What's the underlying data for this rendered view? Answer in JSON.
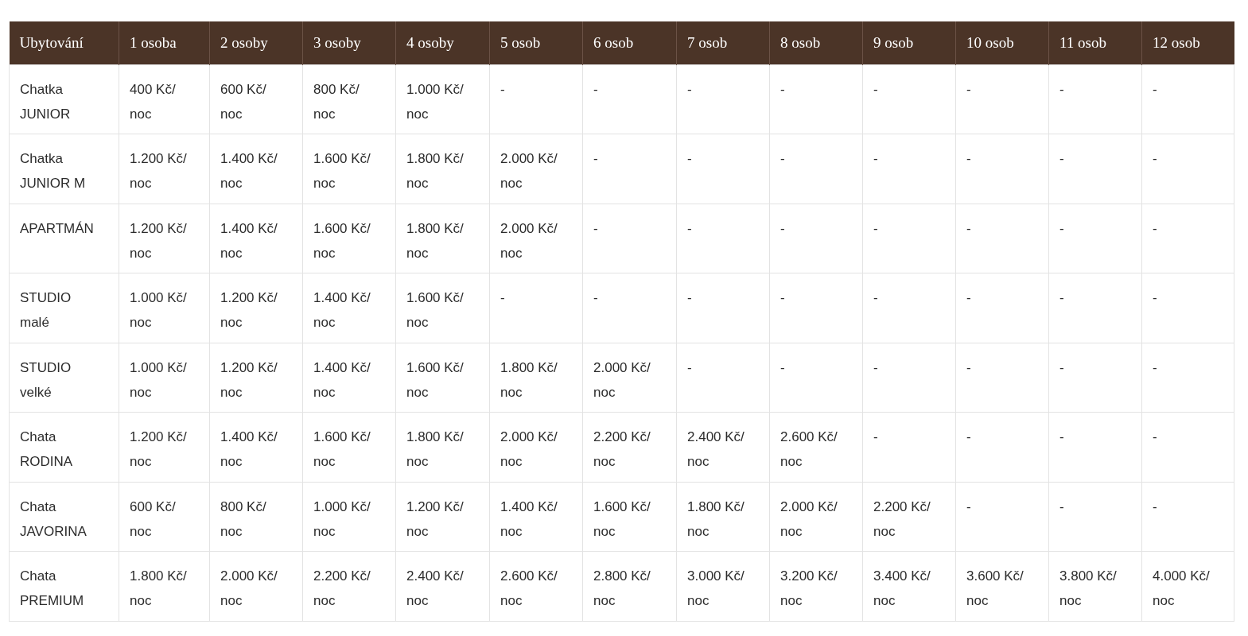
{
  "table": {
    "columns": [
      "Ubytování",
      "1 osoba",
      "2 osoby",
      "3 osoby",
      "4 osoby",
      "5 osob",
      "6 osob",
      "7 osob",
      "8 osob",
      "9 osob",
      "10 osob",
      "11 osob",
      "12 osob"
    ],
    "rows": [
      [
        "Chatka JUNIOR",
        "400 Kč/ noc",
        "600 Kč/ noc",
        "800 Kč/ noc",
        "1.000 Kč/ noc",
        "-",
        "-",
        "-",
        "-",
        "-",
        "-",
        "-",
        "-"
      ],
      [
        "Chatka JUNIOR M",
        "1.200 Kč/ noc",
        "1.400 Kč/ noc",
        "1.600 Kč/ noc",
        "1.800 Kč/ noc",
        "2.000 Kč/ noc",
        "-",
        "-",
        "-",
        "-",
        "-",
        "-",
        "-"
      ],
      [
        "APARTMÁN",
        "1.200 Kč/ noc",
        "1.400 Kč/ noc",
        "1.600 Kč/ noc",
        "1.800 Kč/ noc",
        "2.000 Kč/ noc",
        "-",
        "-",
        "-",
        "-",
        "-",
        "-",
        "-"
      ],
      [
        "STUDIO malé",
        "1.000 Kč/ noc",
        "1.200 Kč/ noc",
        "1.400 Kč/ noc",
        "1.600 Kč/ noc",
        "-",
        "-",
        "-",
        "-",
        "-",
        "-",
        "-",
        "-"
      ],
      [
        "STUDIO velké",
        "1.000 Kč/ noc",
        "1.200 Kč/ noc",
        "1.400 Kč/ noc",
        "1.600 Kč/ noc",
        "1.800 Kč/ noc",
        "2.000 Kč/ noc",
        "-",
        "-",
        "-",
        "-",
        "-",
        "-"
      ],
      [
        "Chata RODINA",
        "1.200 Kč/ noc",
        "1.400 Kč/ noc",
        "1.600 Kč/ noc",
        "1.800 Kč/ noc",
        "2.000 Kč/ noc",
        "2.200 Kč/ noc",
        "2.400 Kč/ noc",
        "2.600 Kč/ noc",
        "-",
        "-",
        "-",
        "-"
      ],
      [
        "Chata JAVORINA",
        "600 Kč/ noc",
        "800 Kč/ noc",
        "1.000 Kč/ noc",
        "1.200 Kč/ noc",
        "1.400 Kč/ noc",
        "1.600 Kč/ noc",
        "1.800 Kč/ noc",
        "2.000 Kč/ noc",
        "2.200 Kč/ noc",
        "-",
        "-",
        "-"
      ],
      [
        "Chata PREMIUM",
        "1.800 Kč/ noc",
        "2.000 Kč/ noc",
        "2.200 Kč/ noc",
        "2.400 Kč/ noc",
        "2.600 Kč/ noc",
        "2.800 Kč/ noc",
        "3.000 Kč/ noc",
        "3.200 Kč/ noc",
        "3.400 Kč/ noc",
        "3.600 Kč/ noc",
        "3.800 Kč/ noc",
        "4.000 Kč/ noc"
      ]
    ]
  }
}
